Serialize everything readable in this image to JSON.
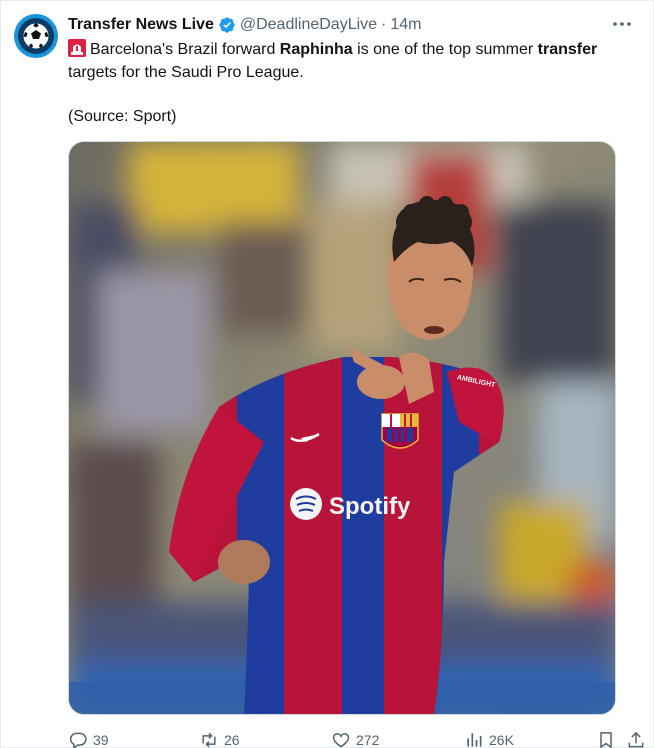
{
  "account": {
    "display_name": "Transfer News Live",
    "handle": "@DeadlineDayLive",
    "separator": "·",
    "time": "14m",
    "verified": true
  },
  "post": {
    "emoji": "rotating-light",
    "text_parts": [
      {
        "t": "Barcelona's Brazil forward ",
        "bold": false
      },
      {
        "t": "Raphinha",
        "bold": true
      },
      {
        "t": " is one of the top summer ",
        "bold": false
      },
      {
        "t": "transfer",
        "bold": true
      },
      {
        "t": " targets for the Saudi Pro League.",
        "bold": false
      }
    ],
    "source": "(Source: Sport)"
  },
  "media": {
    "jersey_sponsor": "Spotify",
    "sleeve_text": "AMBILIGHT"
  },
  "actions": {
    "replies": "39",
    "reposts": "26",
    "likes": "272",
    "views": "26K"
  },
  "colors": {
    "accent": "#1d9bf0",
    "muted": "#536471",
    "barca_blue": "#1f3d9e",
    "barca_red": "#c0143c"
  }
}
